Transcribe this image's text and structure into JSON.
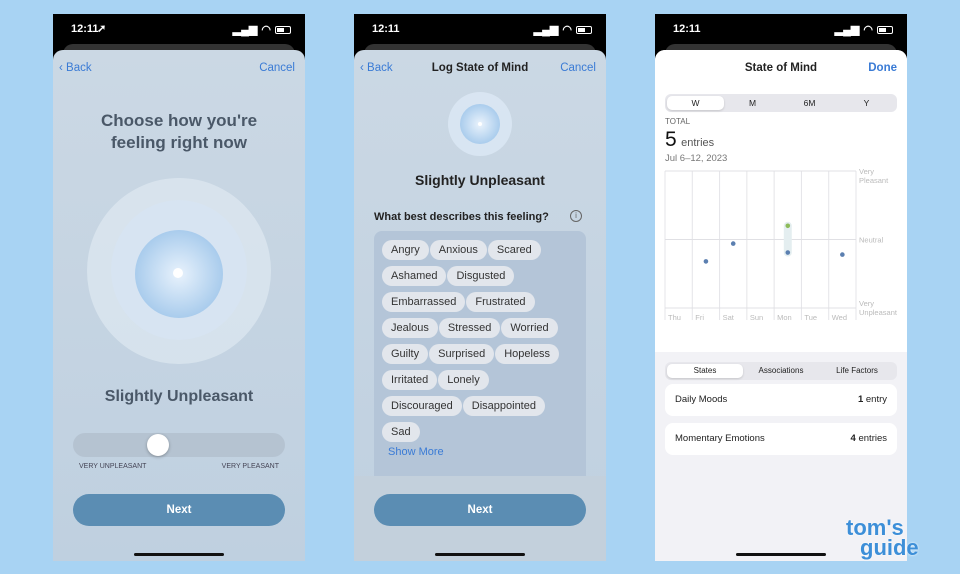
{
  "status": {
    "time": "12:11"
  },
  "screen1": {
    "back": "Back",
    "cancel": "Cancel",
    "heading_line1": "Choose how you're",
    "heading_line2": "feeling right now",
    "mood": "Slightly Unpleasant",
    "slider_value": 0.35,
    "slider_min_label": "VERY UNPLEASANT",
    "slider_max_label": "VERY PLEASANT",
    "next": "Next"
  },
  "screen2": {
    "back": "Back",
    "title": "Log State of Mind",
    "cancel": "Cancel",
    "mood": "Slightly Unpleasant",
    "question": "What best describes this feeling?",
    "info_icon": "info-circle-icon",
    "chips": [
      [
        "Angry",
        "Anxious",
        "Scared"
      ],
      [
        "Ashamed",
        "Disgusted"
      ],
      [
        "Embarrassed",
        "Frustrated"
      ],
      [
        "Jealous",
        "Stressed",
        "Worried"
      ],
      [
        "Guilty",
        "Surprised",
        "Hopeless"
      ],
      [
        "Irritated",
        "Lonely"
      ],
      [
        "Discouraged",
        "Disappointed"
      ],
      [
        "Sad"
      ]
    ],
    "show_more": "Show More",
    "next": "Next"
  },
  "screen3": {
    "title": "State of Mind",
    "done": "Done",
    "ranges": [
      "W",
      "M",
      "6M",
      "Y"
    ],
    "selected_range": "W",
    "total_label": "TOTAL",
    "total_value": "5",
    "total_unit": "entries",
    "date_range": "Jul 6–12, 2023",
    "chart_data": {
      "type": "scatter",
      "categories": [
        "Thu",
        "Fri",
        "Sat",
        "Sun",
        "Mon",
        "Tue",
        "Wed"
      ],
      "y_labels": {
        "top": [
          "Very",
          "Pleasant"
        ],
        "mid": "Neutral",
        "bottom": [
          "Very",
          "Unpleasant"
        ]
      },
      "ylim": [
        -1,
        1
      ],
      "points": [
        {
          "day": "Fri",
          "value": -0.32,
          "kind": "momentary"
        },
        {
          "day": "Sat",
          "value": -0.06,
          "kind": "momentary"
        },
        {
          "day": "Mon",
          "value": 0.2,
          "kind": "daily"
        },
        {
          "day": "Mon",
          "value": -0.19,
          "kind": "momentary"
        },
        {
          "day": "Wed",
          "value": -0.22,
          "kind": "momentary"
        }
      ],
      "colors": {
        "momentary": "#5b7fb0",
        "daily": "#8dbb5a"
      }
    },
    "tabs": [
      "States",
      "Associations",
      "Life Factors"
    ],
    "selected_tab": "States",
    "rows": [
      {
        "label": "Daily Moods",
        "count": "1",
        "unit": "entry"
      },
      {
        "label": "Momentary Emotions",
        "count": "4",
        "unit": "entries"
      }
    ]
  },
  "watermark": {
    "line1": "tom's",
    "line2": "guide"
  }
}
